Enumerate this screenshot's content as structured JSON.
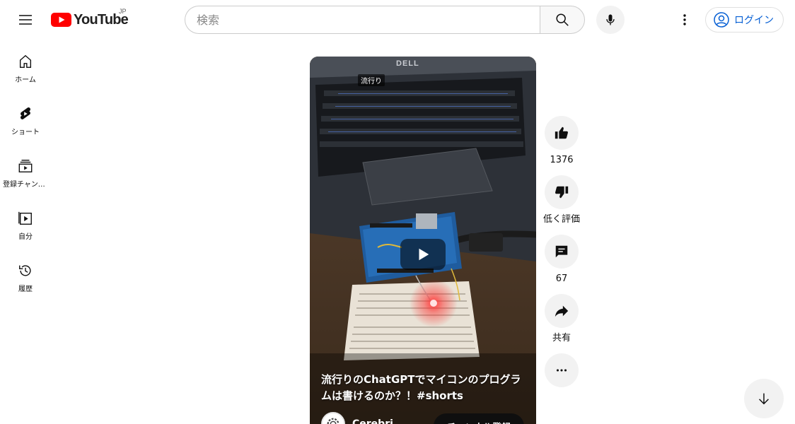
{
  "header": {
    "logo_text": "YouTube",
    "region": "JP",
    "search_placeholder": "検索",
    "login_label": "ログイン"
  },
  "sidebar": {
    "items": [
      {
        "label": "ホーム",
        "icon": "home-icon"
      },
      {
        "label": "ショート",
        "icon": "shorts-icon"
      },
      {
        "label": "登録チャンネル",
        "icon": "subscriptions-icon"
      },
      {
        "label": "自分",
        "icon": "library-icon"
      },
      {
        "label": "履歴",
        "icon": "history-icon"
      }
    ]
  },
  "short": {
    "badge": "流行り",
    "overlay_brand": "DELL",
    "title": "流行りのChatGPTでマイコンのプログラムは書けるのか？！#shorts",
    "channel_name": "Cerebri…",
    "subscribe_label": "チャンネル登録"
  },
  "actions": {
    "like_count": "1376",
    "dislike_label": "低く評価",
    "comment_count": "67",
    "share_label": "共有"
  },
  "colors": {
    "brand_red": "#ff0000",
    "link_blue": "#065fd4",
    "button_bg": "#f2f2f2"
  }
}
